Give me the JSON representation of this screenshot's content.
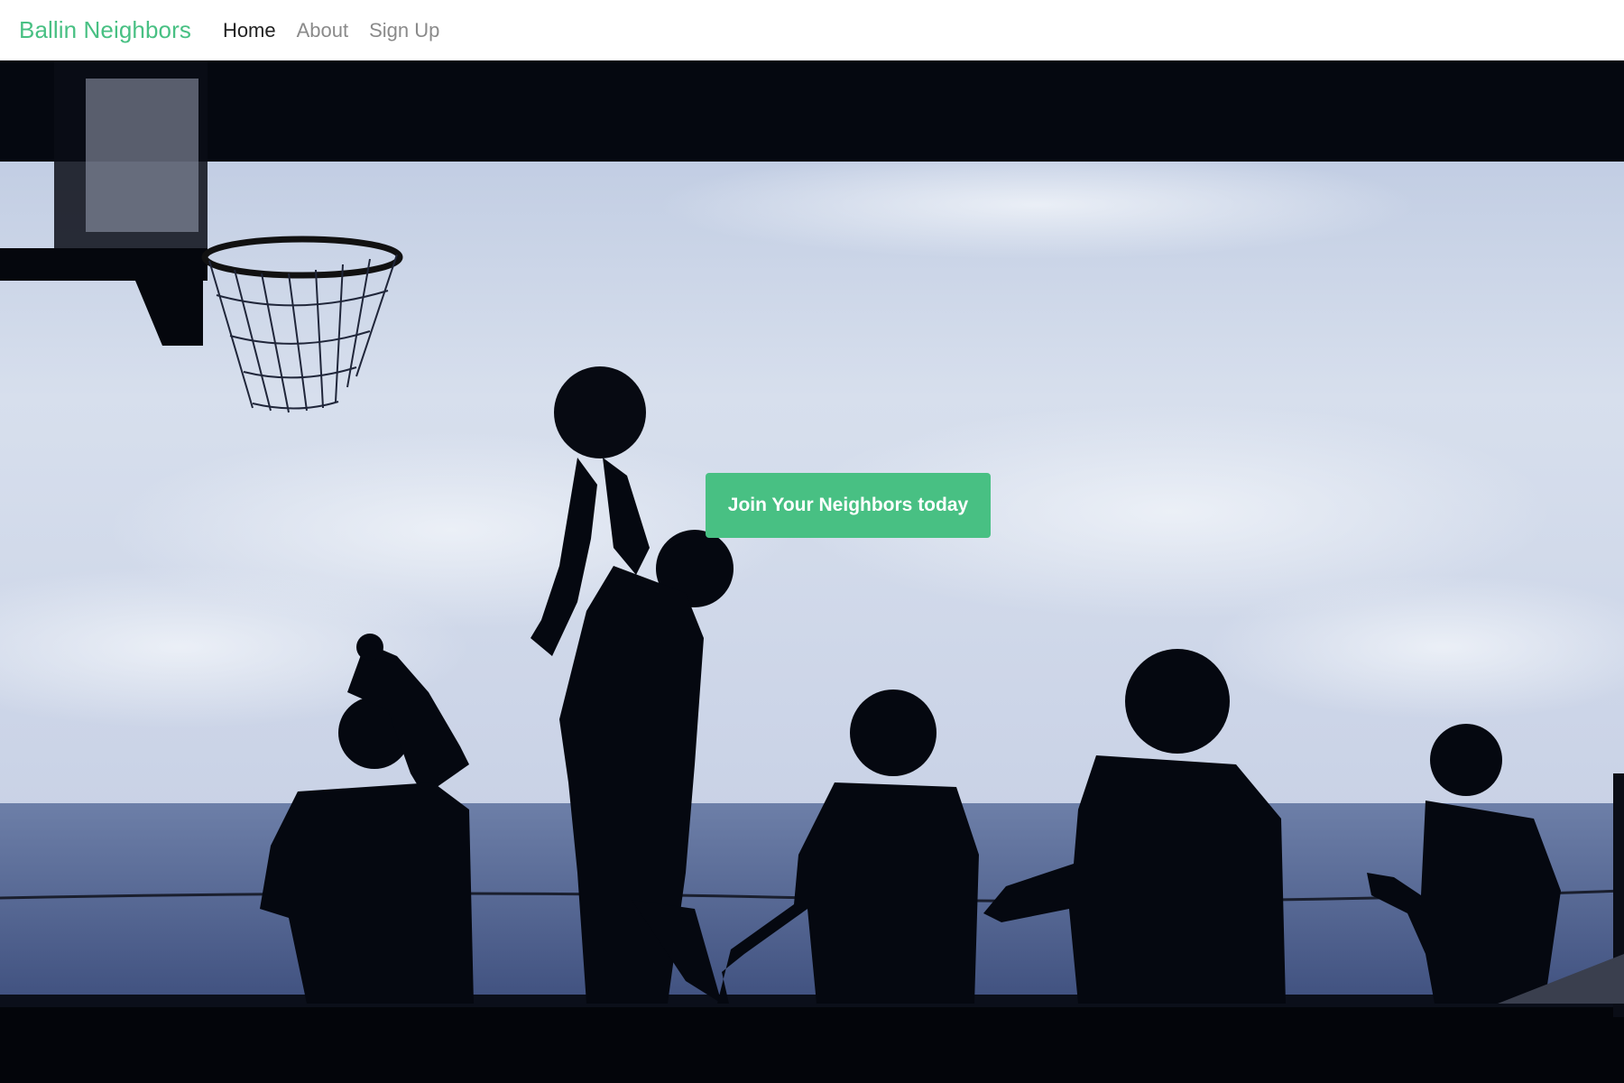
{
  "app": {
    "brand": "Ballin Neighbors",
    "accent_color": "#48c083"
  },
  "nav": {
    "items": [
      {
        "label": "Home",
        "active": true
      },
      {
        "label": "About",
        "active": false
      },
      {
        "label": "Sign Up",
        "active": false
      }
    ]
  },
  "hero": {
    "background": "basketball-silhouette-photo",
    "cta_label": "Join Your Neighbors today"
  }
}
